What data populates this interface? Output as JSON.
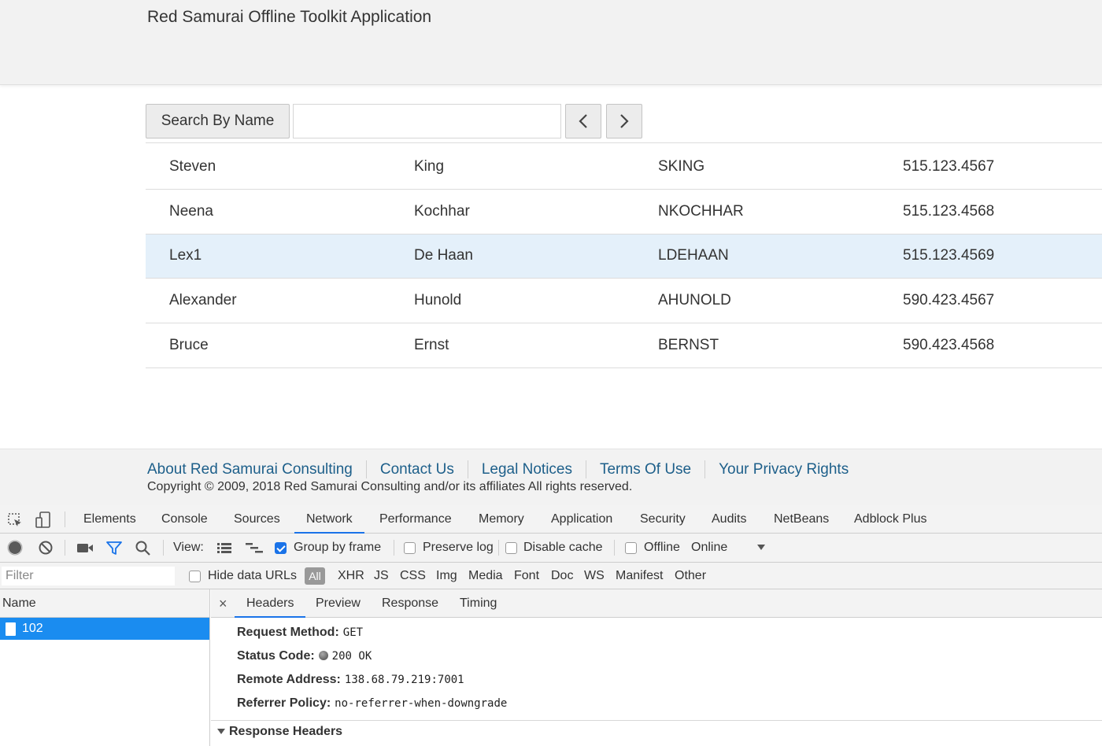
{
  "app": {
    "title": "Red Samurai Offline Toolkit Application"
  },
  "search": {
    "button_label": "Search By Name",
    "value": "",
    "placeholder": "",
    "prev_icon": "chevron-left-icon",
    "next_icon": "chevron-right-icon"
  },
  "employees": [
    {
      "first": "Steven",
      "last": "King",
      "email": "SKING",
      "phone": "515.123.4567",
      "selected": false
    },
    {
      "first": "Neena",
      "last": "Kochhar",
      "email": "NKOCHHAR",
      "phone": "515.123.4568",
      "selected": false
    },
    {
      "first": "Lex1",
      "last": "De Haan",
      "email": "LDEHAAN",
      "phone": "515.123.4569",
      "selected": true
    },
    {
      "first": "Alexander",
      "last": "Hunold",
      "email": "AHUNOLD",
      "phone": "590.423.4567",
      "selected": false
    },
    {
      "first": "Bruce",
      "last": "Ernst",
      "email": "BERNST",
      "phone": "590.423.4568",
      "selected": false
    }
  ],
  "footer": {
    "links": [
      "About Red Samurai Consulting",
      "Contact Us",
      "Legal Notices",
      "Terms Of Use",
      "Your Privacy Rights"
    ],
    "copyright": "Copyright © 2009, 2018 Red Samurai Consulting and/or its affiliates All rights reserved."
  },
  "devtools": {
    "tabs": [
      "Elements",
      "Console",
      "Sources",
      "Network",
      "Performance",
      "Memory",
      "Application",
      "Security",
      "Audits",
      "NetBeans",
      "Adblock Plus"
    ],
    "active_tab": "Network",
    "toolbar": {
      "view_label": "View:",
      "group_by_frame": {
        "label": "Group by frame",
        "checked": true
      },
      "preserve_log": {
        "label": "Preserve log",
        "checked": false
      },
      "disable_cache": {
        "label": "Disable cache",
        "checked": false
      },
      "offline": {
        "label": "Offline",
        "checked": false
      },
      "throttle": "Online"
    },
    "filter": {
      "placeholder": "Filter",
      "hide_data_urls": {
        "label": "Hide data URLs",
        "checked": false
      },
      "types": [
        "All",
        "XHR",
        "JS",
        "CSS",
        "Img",
        "Media",
        "Font",
        "Doc",
        "WS",
        "Manifest",
        "Other"
      ],
      "active_type": "All"
    },
    "name_column": "Name",
    "requests": [
      {
        "name": "102",
        "selected": true
      }
    ],
    "detail_tabs": [
      "Headers",
      "Preview",
      "Response",
      "Timing"
    ],
    "active_detail_tab": "Headers",
    "general": {
      "request_method_label": "Request Method:",
      "request_method": "GET",
      "status_code_label": "Status Code:",
      "status_code": "200 OK",
      "remote_address_label": "Remote Address:",
      "remote_address": "138.68.79.219:7001",
      "referrer_policy_label": "Referrer Policy:",
      "referrer_policy": "no-referrer-when-downgrade"
    },
    "response_headers_label": "Response Headers"
  }
}
